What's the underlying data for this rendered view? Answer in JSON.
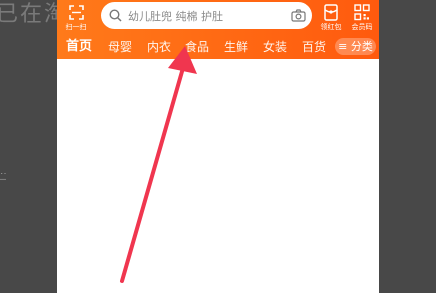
{
  "background": {
    "text": "已在淘",
    "dash": "‥\n—"
  },
  "header": {
    "scan_label": "扫一扫",
    "search_placeholder": "幼儿肚兜 纯棉 护肚",
    "red_packet_label": "领红包",
    "member_code_label": "会员码"
  },
  "tabs": [
    {
      "label": "首页",
      "active": true
    },
    {
      "label": "母婴",
      "active": false
    },
    {
      "label": "内衣",
      "active": false
    },
    {
      "label": "食品",
      "active": false
    },
    {
      "label": "生鲜",
      "active": false
    },
    {
      "label": "女装",
      "active": false
    },
    {
      "label": "百货",
      "active": false
    }
  ],
  "category_button": "≡ 分类",
  "colors": {
    "brand_orange": "#ff6a14",
    "arrow_red": "#f0364f"
  },
  "icons": {
    "scan": "scan-icon",
    "search": "search-icon",
    "camera": "camera-icon",
    "red_packet": "red-packet-icon",
    "member_code": "qr-code-icon"
  }
}
